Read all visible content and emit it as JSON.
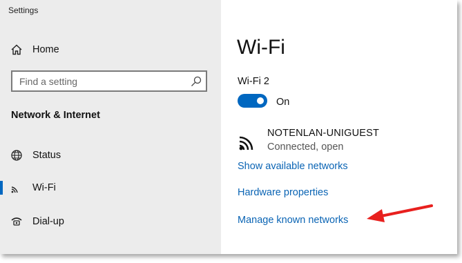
{
  "app_title": "Settings",
  "sidebar": {
    "home_label": "Home",
    "search": {
      "placeholder": "Find a setting",
      "value": ""
    },
    "section_header": "Network & Internet",
    "items": [
      {
        "label": "Status",
        "icon": "globe-icon"
      },
      {
        "label": "Wi-Fi",
        "icon": "wifi-icon",
        "selected": true
      },
      {
        "label": "Dial-up",
        "icon": "dialup-icon"
      }
    ]
  },
  "main": {
    "title": "Wi-Fi",
    "adapter_name": "Wi-Fi 2",
    "toggle": {
      "state": "On",
      "on": true
    },
    "network": {
      "name": "NOTENLAN-UNIGUEST",
      "status": "Connected, open"
    },
    "links": [
      {
        "label": "Show available networks"
      },
      {
        "label": "Hardware properties"
      },
      {
        "label": "Manage known networks"
      }
    ]
  },
  "colors": {
    "accent": "#0067c0",
    "link": "#0a64b4",
    "annotation_arrow": "#e8201e",
    "sidebar_bg": "#ececec"
  }
}
